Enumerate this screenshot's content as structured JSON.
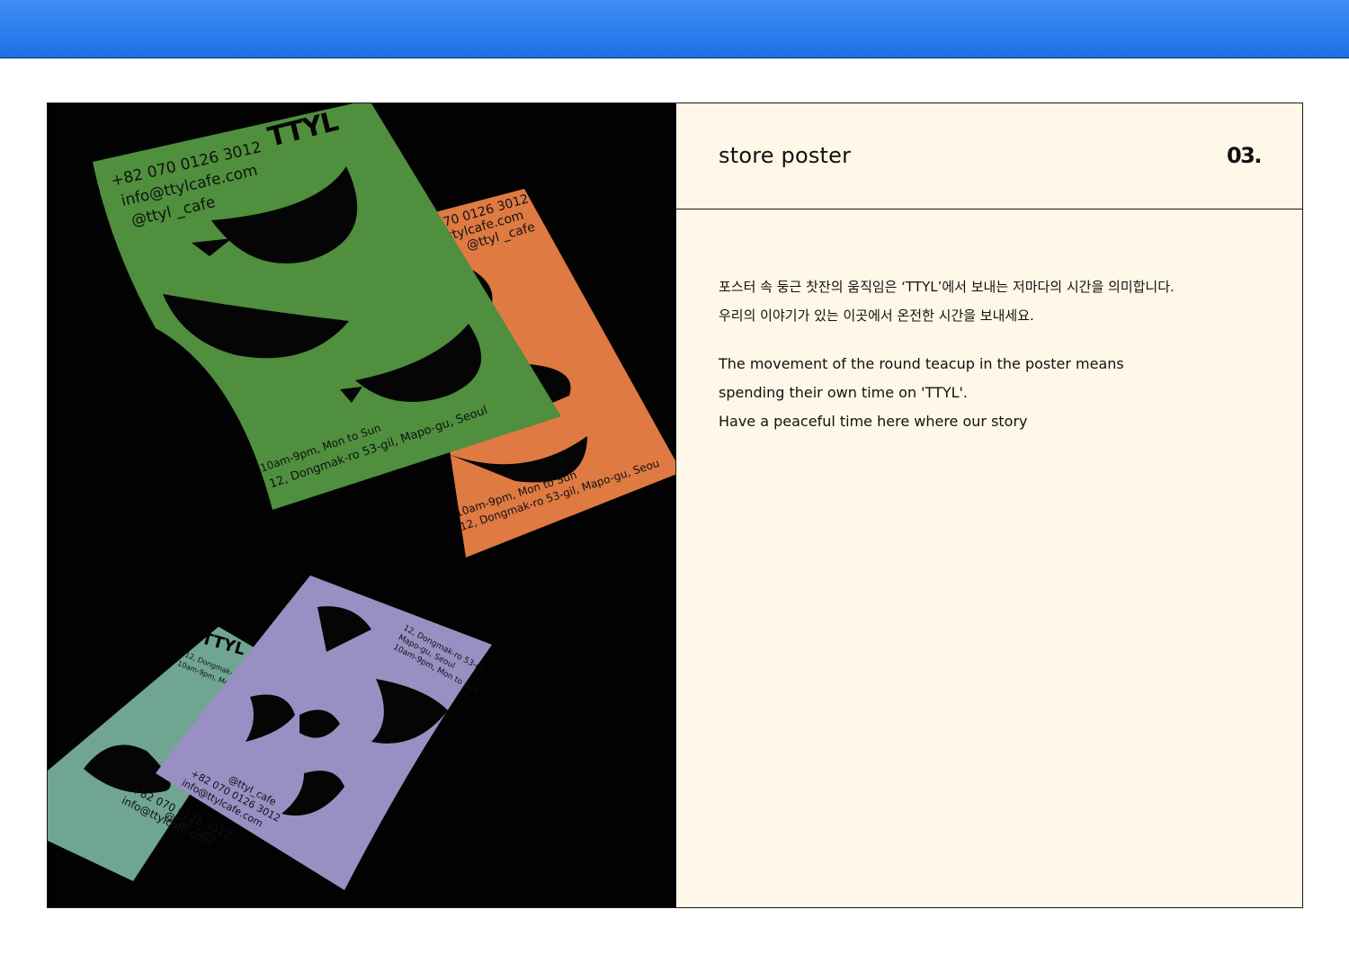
{
  "panel": {
    "title": "store poster",
    "number": "03.",
    "korean_lines": [
      "포스터 속 둥근 찻잔의 움직임은 ‘TTYL’에서 보내는 저마다의 시간을 의미합니다.",
      "우리의 이야기가 있는 이곳에서 온전한 시간을 보내세요."
    ],
    "english_lines": [
      "The movement of the round teacup in the poster means",
      "spending their own time on 'TTYL'.",
      "Have a peaceful time here where our story"
    ]
  },
  "posters": {
    "green": {
      "color": "#4f8f3d",
      "logo": "TTYL",
      "contact": [
        "+82  070 0126 3012",
        "info@ttylcafe.com",
        "@ttyl _cafe"
      ],
      "footer": [
        "10am-9pm, Mon to Sun",
        "12, Dongmak-ro 53-gil, Mapo-gu, Seoul"
      ]
    },
    "orange": {
      "color": "#de7a42",
      "contact": [
        "2 070 0126 3012",
        "o@ttylcafe.com",
        "@ttyl _cafe"
      ],
      "footer": [
        "10am-9pm, Mon to Sun",
        "12, Dongmak-ro 53-gil, Mapo-gu, Seou"
      ]
    },
    "purple": {
      "color": "#9a8fc2",
      "address": [
        "12, Dongmak-ro 53-gil,",
        "Mapo-gu, Seoul",
        "10am-9pm, Mon to Sun"
      ],
      "contact": [
        "@ttyl_cafe",
        "+82  070 0126 3012",
        "info@ttylcafe.com"
      ]
    },
    "teal": {
      "color": "#70a592",
      "logo": "TTYL",
      "address": [
        "12, Dongmak-ro 53",
        "10am-9pm, Mon to S"
      ],
      "contact": [
        "@ttyl_cafe",
        "+82  070 0126 3012",
        "info@ttylcafe.com"
      ]
    }
  },
  "colors": {
    "accent_top": "#2a7ff0",
    "panel_bg": "#fff8e9",
    "photo_bg": "#020202"
  }
}
